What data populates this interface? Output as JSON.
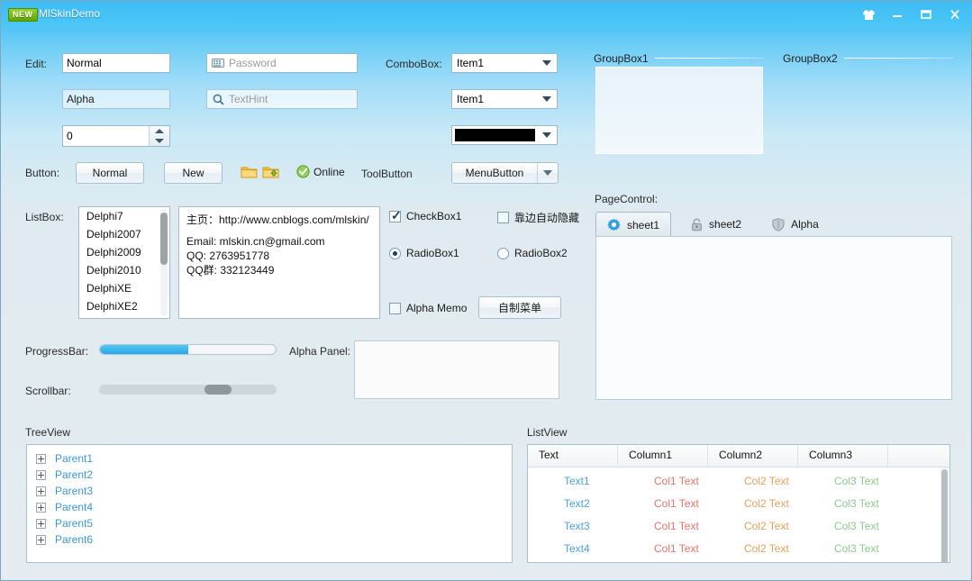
{
  "window": {
    "badge": "NEW",
    "title": "MlSkinDemo",
    "controls": {
      "skin": "skin-shirt-icon",
      "minimize": "minimize-icon",
      "maximize": "maximize-icon",
      "close": "close-icon"
    }
  },
  "edit_section": {
    "label": "Edit:",
    "normal_value": "Normal",
    "alpha_value": "Alpha",
    "spin_value": "0",
    "password_placeholder": "Password",
    "password_icon": "keyboard-icon",
    "texthint_placeholder": "TextHint",
    "texthint_icon": "search-icon"
  },
  "combo_section": {
    "label": "ComboBox:",
    "combo1_value": "Item1",
    "combo2_value": "Item1",
    "color_value": "#000000"
  },
  "button_section": {
    "label": "Button:",
    "normal": "Normal",
    "new": "New",
    "folder_icon": "folder-icon",
    "folder_upload_icon": "folder-upload-icon",
    "online": "Online",
    "online_icon": "green-check-icon",
    "toolbutton": "ToolButton",
    "menubutton": "MenuButton"
  },
  "listbox_section": {
    "label": "ListBox:",
    "items": [
      "Delphi7",
      "Delphi2007",
      "Delphi2009",
      "Delphi2010",
      "DelphiXE",
      "DelphiXE2"
    ]
  },
  "memo": {
    "lines": [
      "主页：http://www.cnblogs.com/mlskin/",
      "",
      "Email: mlskin.cn@gmail.com",
      "QQ: 2763951778",
      "QQ群: 332123449"
    ]
  },
  "checks": {
    "checkbox1": "CheckBox1",
    "checkbox1_checked": true,
    "autohide": "靠边自动隐藏",
    "autohide_checked": false,
    "radio1": "RadioBox1",
    "radio1_selected": true,
    "radio2": "RadioBox2",
    "radio2_selected": false,
    "alpha_memo": "Alpha Memo",
    "alpha_memo_checked": false,
    "custom_menu_button": "自制菜单"
  },
  "groupboxes": {
    "group1": "GroupBox1",
    "group2": "GroupBox2"
  },
  "pagecontrol": {
    "label": "PageControl:",
    "tabs": [
      {
        "label": "sheet1",
        "icon": "gear-icon",
        "active": true
      },
      {
        "label": "sheet2",
        "icon": "lock-icon",
        "active": false
      },
      {
        "label": "Alpha",
        "icon": "shield-icon",
        "active": false
      }
    ]
  },
  "bars": {
    "progress_label": "ProgressBar:",
    "progress_percent": 50,
    "scrollbar_label": "Scrollbar:",
    "scroll_position_percent": 70,
    "alpha_panel_label": "Alpha Panel:"
  },
  "treeview": {
    "label": "TreeView",
    "nodes": [
      "Parent1",
      "Parent2",
      "Parent3",
      "Parent4",
      "Parent5",
      "Parent6"
    ]
  },
  "listview": {
    "label": "ListView",
    "columns": [
      "Text",
      "Column1",
      "Column2",
      "Column3"
    ],
    "rows": [
      [
        "Text1",
        "Col1 Text",
        "Col2 Text",
        "Col3 Text"
      ],
      [
        "Text2",
        "Col1 Text",
        "Col2 Text",
        "Col3 Text"
      ],
      [
        "Text3",
        "Col1 Text",
        "Col2 Text",
        "Col3 Text"
      ],
      [
        "Text4",
        "Col1 Text",
        "Col2 Text",
        "Col3 Text"
      ]
    ],
    "colors": {
      "text": "#4aa3dd",
      "col1": "#e8736a",
      "col2": "#e8a05a",
      "col3": "#8fc98f"
    }
  }
}
